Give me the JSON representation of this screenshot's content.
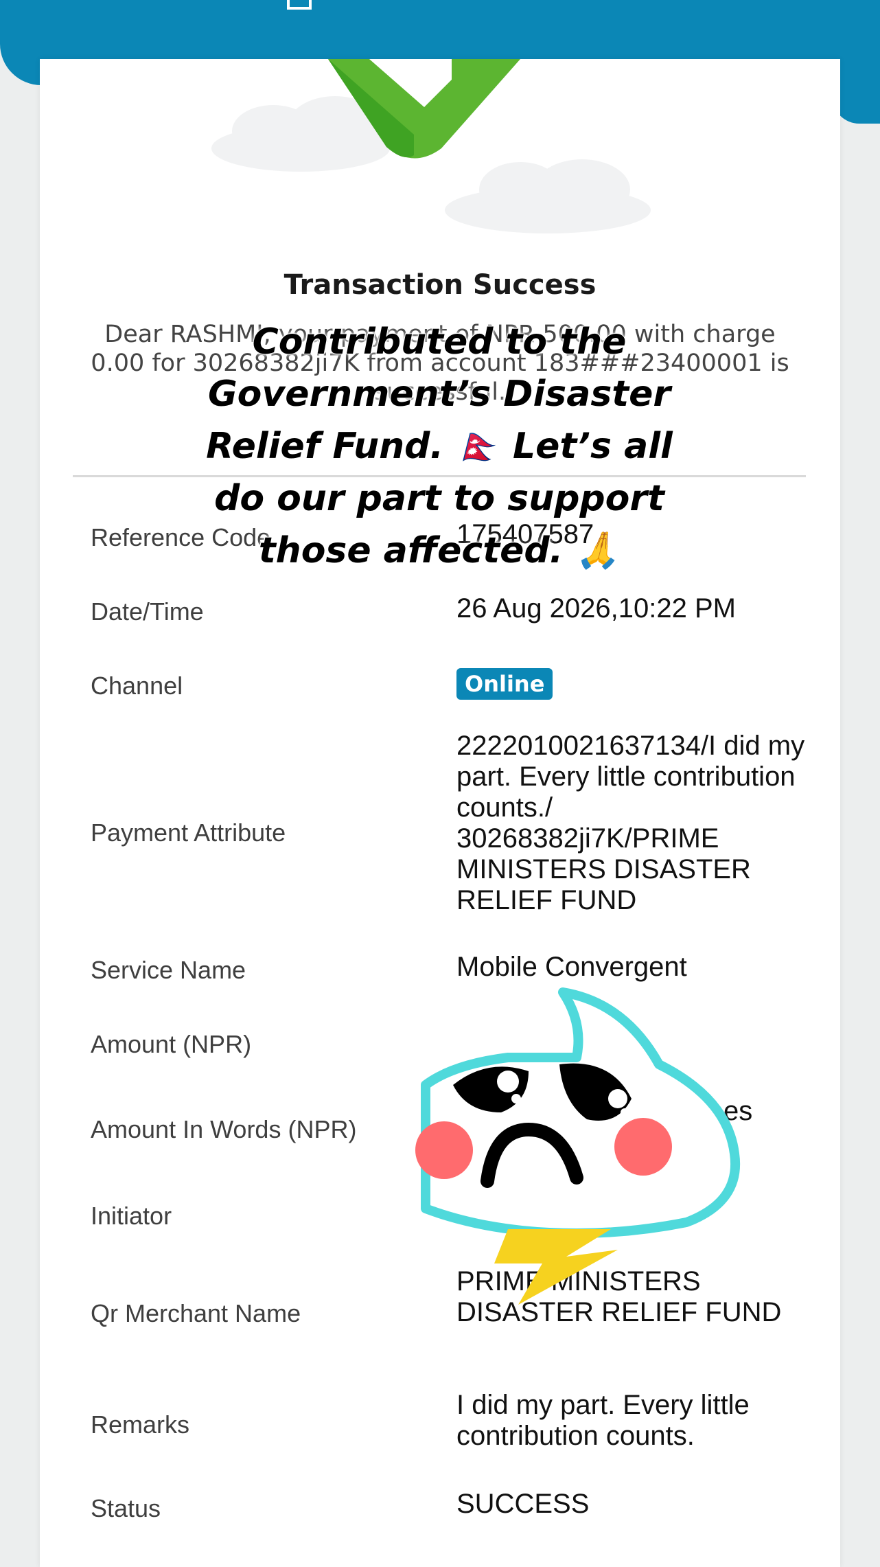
{
  "colors": {
    "brand": "#0b87b6",
    "success_green": "#5cb531",
    "sticker_cyan": "#4fd9db",
    "cheek_pink": "#ff6b6e",
    "bolt_yellow": "#f6d21f"
  },
  "receipt": {
    "title": "Transaction Success",
    "message": "Dear RASHMI, your payment of NPR 500.00 with charge 0.00 for 30268382ji7K from account 183###23400001 is successful."
  },
  "details": {
    "reference_code_label": "Reference Code",
    "reference_code_value": "175407587",
    "datetime_label": "Date/Time",
    "datetime_value": "26 Aug 2026,10:22 PM",
    "channel_label": "Channel",
    "channel_value": "Online",
    "payment_attribute_label": "Payment Attribute",
    "payment_attribute_value": "2222010021637134/I did my part.  Every little contribution counts./ 30268382ji7K/PRIME MINISTERS DISASTER RELIEF FUND",
    "service_name_label": "Service Name",
    "service_name_value": "Mobile Convergent",
    "amount_label": "Amount (NPR)",
    "amount_words_label": "Amount In Words (NPR)",
    "amount_words_value": "es",
    "initiator_label": "Initiator",
    "qr_merchant_label": "Qr Merchant Name",
    "qr_merchant_value": "PRIME MINISTERS DISASTER RELIEF FUND",
    "remarks_label": "Remarks",
    "remarks_value": "I did my part.  Every little contribution counts.",
    "status_label": "Status",
    "status_value": "SUCCESS"
  },
  "story_overlay": {
    "line1": "Contributed to the",
    "line2": "Government’s Disaster",
    "line3": "Relief Fund. 🇳🇵 Let’s all",
    "line4": "do our part to support",
    "line5": "those affected. 🙏"
  },
  "icons": {
    "header": "document-icon",
    "hero": "checkmark-icon",
    "sticker": "sad-cloud-sticker"
  }
}
